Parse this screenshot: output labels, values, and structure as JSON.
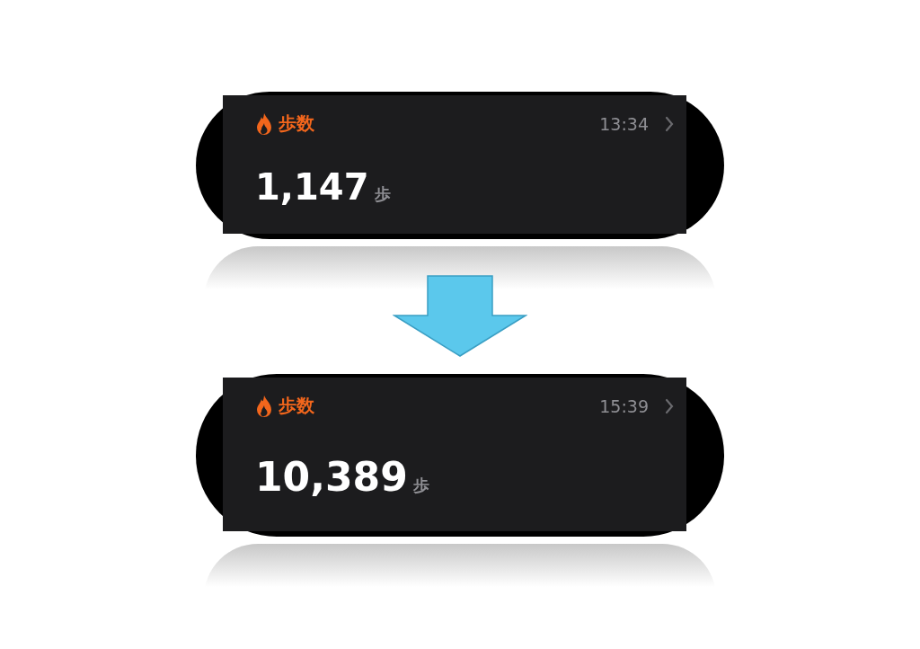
{
  "cards": [
    {
      "title": "歩数",
      "time": "13:34",
      "value": "1,147",
      "unit": "歩"
    },
    {
      "title": "歩数",
      "time": "15:39",
      "value": "10,389",
      "unit": "歩"
    }
  ]
}
